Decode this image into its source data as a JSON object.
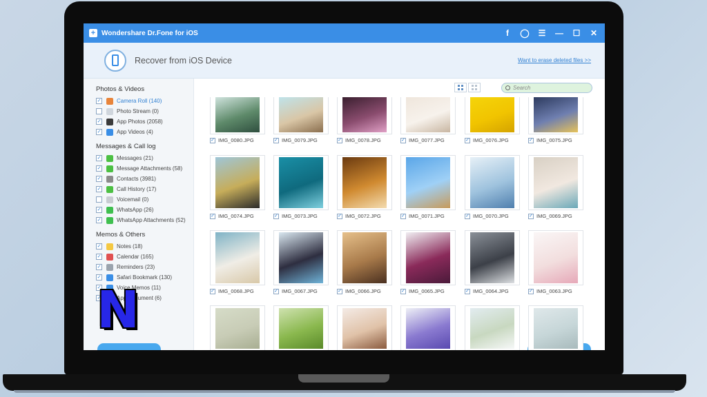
{
  "window": {
    "title": "Wondershare Dr.Fone for iOS",
    "buttons": [
      "f",
      "◯",
      "☰",
      "—",
      "☐",
      "✕"
    ]
  },
  "header": {
    "title": "Recover from iOS Device",
    "erase_link": "Want to erase deleted files >>"
  },
  "search": {
    "placeholder": "Search"
  },
  "sidebar": {
    "sections": [
      {
        "title": "Photos & Videos",
        "items": [
          {
            "label": "Camera Roll (140)",
            "checked": true,
            "active": true,
            "icon": "camera-roll-icon",
            "color": "#e8843a"
          },
          {
            "label": "Photo Stream (0)",
            "checked": false,
            "active": false,
            "icon": "photo-stream-icon",
            "color": "#d0d6dd"
          },
          {
            "label": "App Photos (2058)",
            "checked": true,
            "active": false,
            "icon": "app-photos-icon",
            "color": "#3b3b3b"
          },
          {
            "label": "App Videos (4)",
            "checked": true,
            "active": false,
            "icon": "app-videos-icon",
            "color": "#3a8ee6"
          }
        ]
      },
      {
        "title": "Messages & Call log",
        "items": [
          {
            "label": "Messages (21)",
            "checked": true,
            "active": false,
            "icon": "messages-icon",
            "color": "#4cc043"
          },
          {
            "label": "Message Attachments (58)",
            "checked": true,
            "active": false,
            "icon": "attachment-icon",
            "color": "#4cc043"
          },
          {
            "label": "Contacts (3981)",
            "checked": true,
            "active": false,
            "icon": "contacts-icon",
            "color": "#8b8b8b"
          },
          {
            "label": "Call History (17)",
            "checked": true,
            "active": false,
            "icon": "phone-icon",
            "color": "#4cc043"
          },
          {
            "label": "Voicemail (0)",
            "checked": false,
            "active": false,
            "icon": "voicemail-icon",
            "color": "#c8ccd2"
          },
          {
            "label": "WhatsApp (26)",
            "checked": true,
            "active": false,
            "icon": "whatsapp-icon",
            "color": "#3fbf4f"
          },
          {
            "label": "WhatsApp Attachments (52)",
            "checked": true,
            "active": false,
            "icon": "whatsapp-attachment-icon",
            "color": "#3fbf4f"
          }
        ]
      },
      {
        "title": "Memos & Others",
        "items": [
          {
            "label": "Notes (18)",
            "checked": true,
            "active": false,
            "icon": "notes-icon",
            "color": "#f4c842"
          },
          {
            "label": "Calendar (165)",
            "checked": true,
            "active": false,
            "icon": "calendar-icon",
            "color": "#e05050"
          },
          {
            "label": "Reminders (23)",
            "checked": true,
            "active": false,
            "icon": "reminders-icon",
            "color": "#9aa3ad"
          },
          {
            "label": "Safari Bookmark (130)",
            "checked": true,
            "active": false,
            "icon": "safari-icon",
            "color": "#3a8ee6"
          },
          {
            "label": "Voice Memos (11)",
            "checked": true,
            "active": false,
            "icon": "voice-memo-icon",
            "color": "#3a8ee6"
          },
          {
            "label": "App Document (6)",
            "checked": true,
            "active": false,
            "icon": "app-document-icon",
            "color": "#8b8b8b"
          }
        ]
      }
    ]
  },
  "photos": [
    {
      "name": "IMG_0080.JPG",
      "colors": [
        "#cfe3dd",
        "#5e8a6a",
        "#2f4f3f"
      ]
    },
    {
      "name": "IMG_0079.JPG",
      "colors": [
        "#bfe3ea",
        "#d9c6a6",
        "#8a6e4e"
      ]
    },
    {
      "name": "IMG_0078.JPG",
      "colors": [
        "#3a1f2f",
        "#8a4c6e",
        "#e0a0c6"
      ]
    },
    {
      "name": "IMG_0077.JPG",
      "colors": [
        "#efe6dc",
        "#f7f2ec",
        "#c8b6a2"
      ]
    },
    {
      "name": "IMG_0076.JPG",
      "colors": [
        "#f5d40a",
        "#f1c400",
        "#d4a300"
      ]
    },
    {
      "name": "IMG_0075.JPG",
      "colors": [
        "#2c3a5e",
        "#6f7fb0",
        "#e6c25a"
      ]
    },
    {
      "name": "IMG_0074.JPG",
      "colors": [
        "#9fc6d8",
        "#c6ad5a",
        "#2b2b2b"
      ]
    },
    {
      "name": "IMG_0073.JPG",
      "colors": [
        "#1a8fa6",
        "#0f6a7e",
        "#7fd0df"
      ]
    },
    {
      "name": "IMG_0072.JPG",
      "colors": [
        "#6a3a10",
        "#d08a30",
        "#f3dcb0"
      ]
    },
    {
      "name": "IMG_0071.JPG",
      "colors": [
        "#5aa6e8",
        "#9fd0f6",
        "#c79a5a"
      ]
    },
    {
      "name": "IMG_0070.JPG",
      "colors": [
        "#e6f0f7",
        "#9fc3de",
        "#4f7fae"
      ]
    },
    {
      "name": "IMG_0069.JPG",
      "colors": [
        "#d8d0c4",
        "#f1e8e0",
        "#6aa8b8"
      ]
    },
    {
      "name": "IMG_0068.JPG",
      "colors": [
        "#7fb3c6",
        "#f0ede6",
        "#d8c8a8"
      ]
    },
    {
      "name": "IMG_0067.JPG",
      "colors": [
        "#d9e7f0",
        "#2e2e40",
        "#6fb3d8"
      ]
    },
    {
      "name": "IMG_0066.JPG",
      "colors": [
        "#e6c08a",
        "#a87a4a",
        "#4a3020"
      ]
    },
    {
      "name": "IMG_0065.JPG",
      "colors": [
        "#f0eef2",
        "#8a2a5a",
        "#4a1a3a"
      ]
    },
    {
      "name": "IMG_0064.JPG",
      "colors": [
        "#8a9098",
        "#3c4048",
        "#dcdfe2"
      ]
    },
    {
      "name": "IMG_0063.JPG",
      "colors": [
        "#faf6f6",
        "#f2dede",
        "#e6a8b8"
      ]
    },
    {
      "name": "",
      "colors": [
        "#d6dcc8",
        "#c8ccb6",
        "#a8ae92"
      ]
    },
    {
      "name": "",
      "colors": [
        "#cfe2b0",
        "#8ab84e",
        "#5a8a2a"
      ]
    },
    {
      "name": "",
      "colors": [
        "#f4ebe6",
        "#e0c2a8",
        "#8a5a3e"
      ]
    },
    {
      "name": "",
      "colors": [
        "#eef0f6",
        "#8a7ad0",
        "#5a4ab0"
      ]
    },
    {
      "name": "",
      "colors": [
        "#e2ecf0",
        "#c8d8c0",
        "#f6f8f8"
      ]
    },
    {
      "name": "",
      "colors": [
        "#dfe8ea",
        "#c6d6d8",
        "#a8babc"
      ]
    }
  ],
  "overlay": {
    "logo_letter": "N"
  }
}
